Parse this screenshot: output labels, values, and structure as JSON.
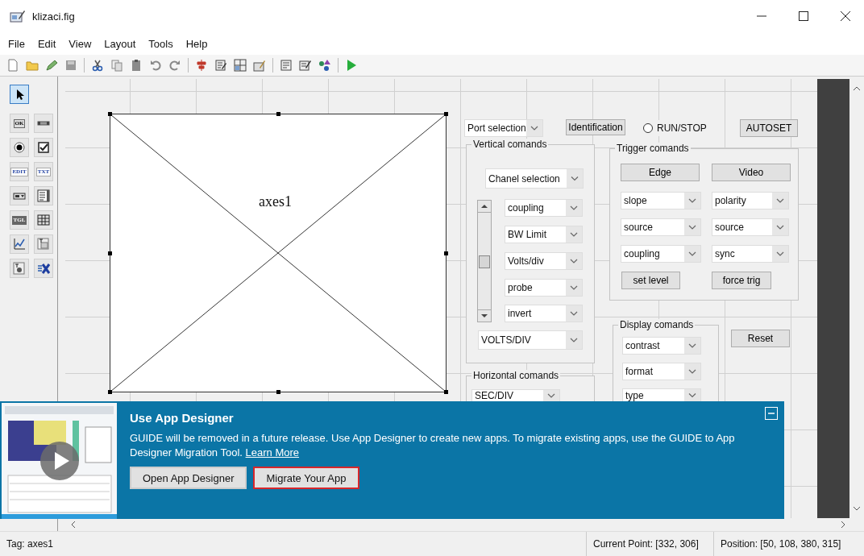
{
  "window": {
    "title": "klizaci.fig"
  },
  "menu": [
    "File",
    "Edit",
    "View",
    "Layout",
    "Tools",
    "Help"
  ],
  "palette": [
    {
      "kind": "pointer",
      "selected": true
    },
    {
      "kind": "pushbutton",
      "label": "OK",
      "selected": false
    },
    {
      "kind": "slider",
      "selected": false
    },
    {
      "kind": "radio",
      "selected": false
    },
    {
      "kind": "checkbox",
      "selected": false
    },
    {
      "kind": "edit",
      "label": "EDIT",
      "selected": false
    },
    {
      "kind": "text",
      "label": "TXT",
      "selected": false
    },
    {
      "kind": "popup",
      "selected": false
    },
    {
      "kind": "listbox",
      "selected": false
    },
    {
      "kind": "toggle",
      "label": "TGL",
      "selected": false
    },
    {
      "kind": "table",
      "selected": false
    },
    {
      "kind": "axes",
      "selected": false
    },
    {
      "kind": "panel",
      "selected": false
    },
    {
      "kind": "buttongroup",
      "selected": false
    },
    {
      "kind": "activex",
      "selected": false
    }
  ],
  "axes": {
    "label": "axes1"
  },
  "port_select": "Port selection",
  "identification_button": "Identification",
  "run_stop": {
    "label": "RUN/STOP",
    "selected": false
  },
  "autoset_button": "AUTOSET",
  "vertical_panel": {
    "title": "Vertical comands",
    "channel_select": "Chanel selection",
    "slider": {
      "level": 0.5
    },
    "dropdowns": [
      "coupling",
      "BW Limit",
      "Volts/div",
      "probe",
      "invert"
    ],
    "volts_select": "VOLTS/DIV"
  },
  "trigger_panel": {
    "title": "Trigger comands",
    "buttons": [
      "Edge",
      "Video"
    ],
    "rows": [
      {
        "left": "slope",
        "right": "polarity"
      },
      {
        "left": "source",
        "right": "source"
      },
      {
        "left": "coupling",
        "right": "sync"
      }
    ],
    "actions": [
      "set level",
      "force trig"
    ]
  },
  "display_panel": {
    "title": "Display comands",
    "dropdowns": [
      "contrast",
      "format",
      "type"
    ]
  },
  "reset_button": "Reset",
  "horizontal_panel": {
    "title": "Horizontal comands",
    "dropdowns": [
      "SEC/DIV"
    ]
  },
  "banner": {
    "title": "Use App Designer",
    "text": "GUIDE will be removed in a future release. Use App Designer to create new apps. To migrate existing apps, use the GUIDE to App Designer Migration Tool.",
    "link": "Learn More",
    "buttons": [
      {
        "label": "Open App Designer",
        "highlighted": false
      },
      {
        "label": "Migrate Your App",
        "highlighted": true
      }
    ]
  },
  "status_bar": {
    "tag": "Tag: axes1",
    "current_point": "Current Point: [332, 306]",
    "position": "Position: [50, 108, 380, 315]"
  }
}
